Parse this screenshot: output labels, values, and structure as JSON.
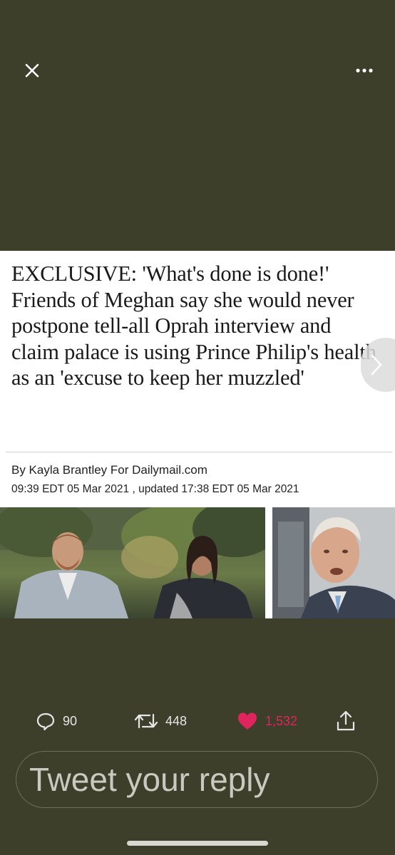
{
  "toolbar": {
    "close_icon": "close-icon",
    "more_icon": "more-horizontal-icon"
  },
  "article": {
    "headline": "EXCLUSIVE: 'What's done is done!' Friends of Meghan say she would never postpone tell-all Oprah interview and claim palace is using Prince Philip's health as an 'excuse to keep her muzzled'",
    "byline": "By Kayla Brantley For Dailymail.com",
    "dateline": "09:39 EDT 05 Mar 2021 , updated 17:38 EDT 05 Mar 2021"
  },
  "actions": {
    "replies": "90",
    "retweets": "448",
    "likes": "1,532",
    "like_color": "#e0245e",
    "text_color": "#e6e6e6"
  },
  "reply": {
    "placeholder": "Tweet your reply"
  },
  "colors": {
    "background": "#3d3f2b",
    "card": "#ffffff"
  }
}
